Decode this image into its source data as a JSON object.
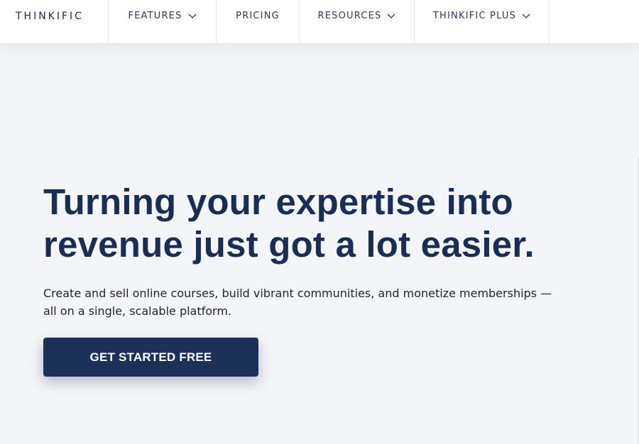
{
  "nav": {
    "logo": "THINKIFIC",
    "items": [
      {
        "label": "FEATURES",
        "has_dropdown": true,
        "icon": "chevron-down-icon"
      },
      {
        "label": "PRICING",
        "has_dropdown": false
      },
      {
        "label": "RESOURCES",
        "has_dropdown": true,
        "icon": "chevron-down-icon"
      },
      {
        "label": "THINKIFIC PLUS",
        "has_dropdown": true,
        "icon": "chevron-down-icon"
      }
    ]
  },
  "hero": {
    "headline": "Turning your expertise into revenue just got a lot easier.",
    "subtext": "Create and sell online courses, build vibrant communities, and monetize memberships — all on a single, scalable platform.",
    "cta_label": "GET STARTED FREE"
  },
  "colors": {
    "brand_navy": "#1a2e55",
    "button_bg": "#1b3159",
    "page_bg": "#f4f5f9",
    "nav_bg": "#ffffff"
  }
}
